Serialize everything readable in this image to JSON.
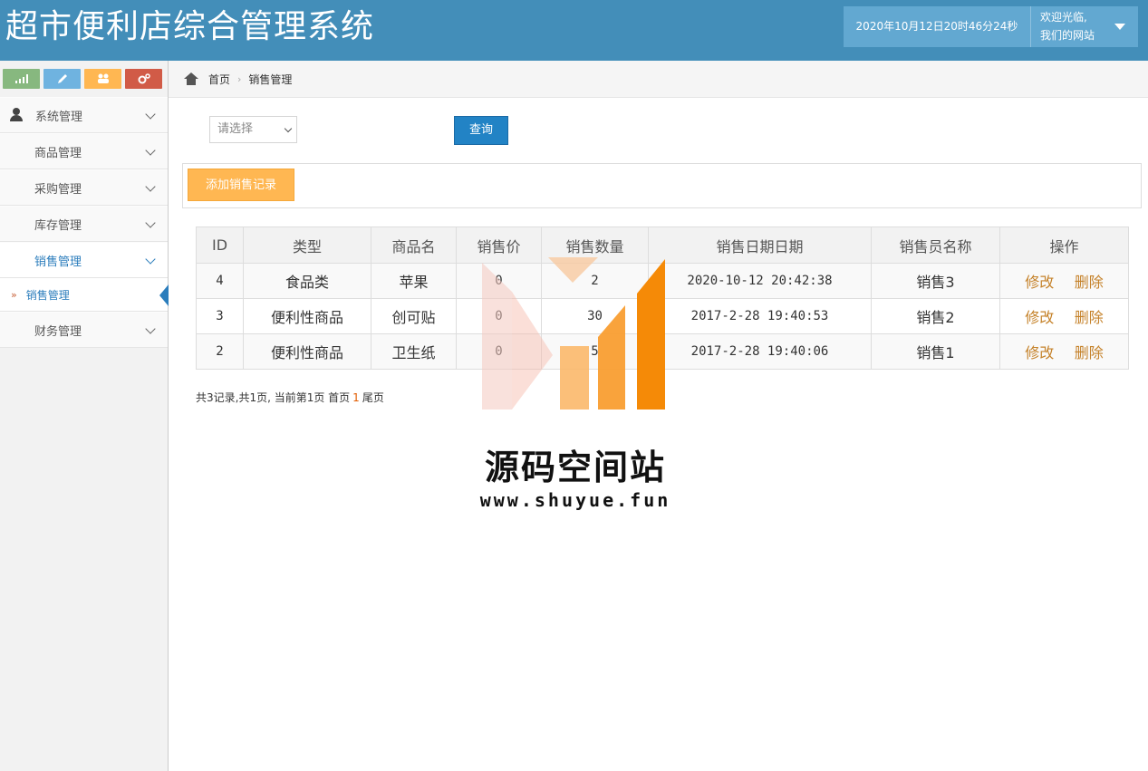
{
  "header": {
    "title": "超市便利店综合管理系统",
    "datetime": "2020年10月12日20时46分24秒",
    "welcome_line1": "欢迎光临,",
    "welcome_line2": "我们的网站"
  },
  "colors": {
    "header_bg": "#438eb9",
    "accent": "#2b7dbc",
    "add_button": "#ffb752",
    "query_button": "#2283c5",
    "link": "#c5822a"
  },
  "shortcuts": [
    {
      "icon": "signal-icon",
      "color": "#87b87f"
    },
    {
      "icon": "pencil-icon",
      "color": "#6fb3e0"
    },
    {
      "icon": "users-icon",
      "color": "#ffb752"
    },
    {
      "icon": "cogs-icon",
      "color": "#d15b47"
    }
  ],
  "sidebar": {
    "items": [
      {
        "label": "系统管理",
        "icon": "user-icon"
      },
      {
        "label": "商品管理",
        "icon": "bookmark-icon"
      },
      {
        "label": "采购管理",
        "icon": "bookmark-icon"
      },
      {
        "label": "库存管理",
        "icon": "bookmark-icon"
      },
      {
        "label": "销售管理",
        "icon": "bookmark-icon",
        "active": true
      },
      {
        "label": "财务管理",
        "icon": "bookmark-icon"
      }
    ],
    "sub_item": "销售管理"
  },
  "breadcrumb": {
    "home": "首页",
    "current": "销售管理"
  },
  "search": {
    "select_value": "请选择",
    "query_label": "查询"
  },
  "toolbar": {
    "add_label": "添加销售记录"
  },
  "table": {
    "headers": [
      "ID",
      "类型",
      "商品名",
      "销售价",
      "销售数量",
      "销售日期日期",
      "销售员名称",
      "操作"
    ],
    "rows": [
      {
        "id": "4",
        "type": "食品类",
        "name": "苹果",
        "price": "0",
        "qty": "2",
        "date": "2020-10-12 20:42:38",
        "seller": "销售3"
      },
      {
        "id": "3",
        "type": "便利性商品",
        "name": "创可贴",
        "price": "0",
        "qty": "30",
        "date": "2017-2-28 19:40:53",
        "seller": "销售2"
      },
      {
        "id": "2",
        "type": "便利性商品",
        "name": "卫生纸",
        "price": "0",
        "qty": "5",
        "date": "2017-2-28 19:40:06",
        "seller": "销售1"
      }
    ],
    "edit_label": "修改",
    "delete_label": "删除"
  },
  "pager": {
    "summary": "共3记录,共1页, 当前第1页 首页",
    "current_page": "1",
    "last": "尾页"
  },
  "watermark": {
    "text": "源码空间站",
    "url": "www.shuyue.fun"
  }
}
